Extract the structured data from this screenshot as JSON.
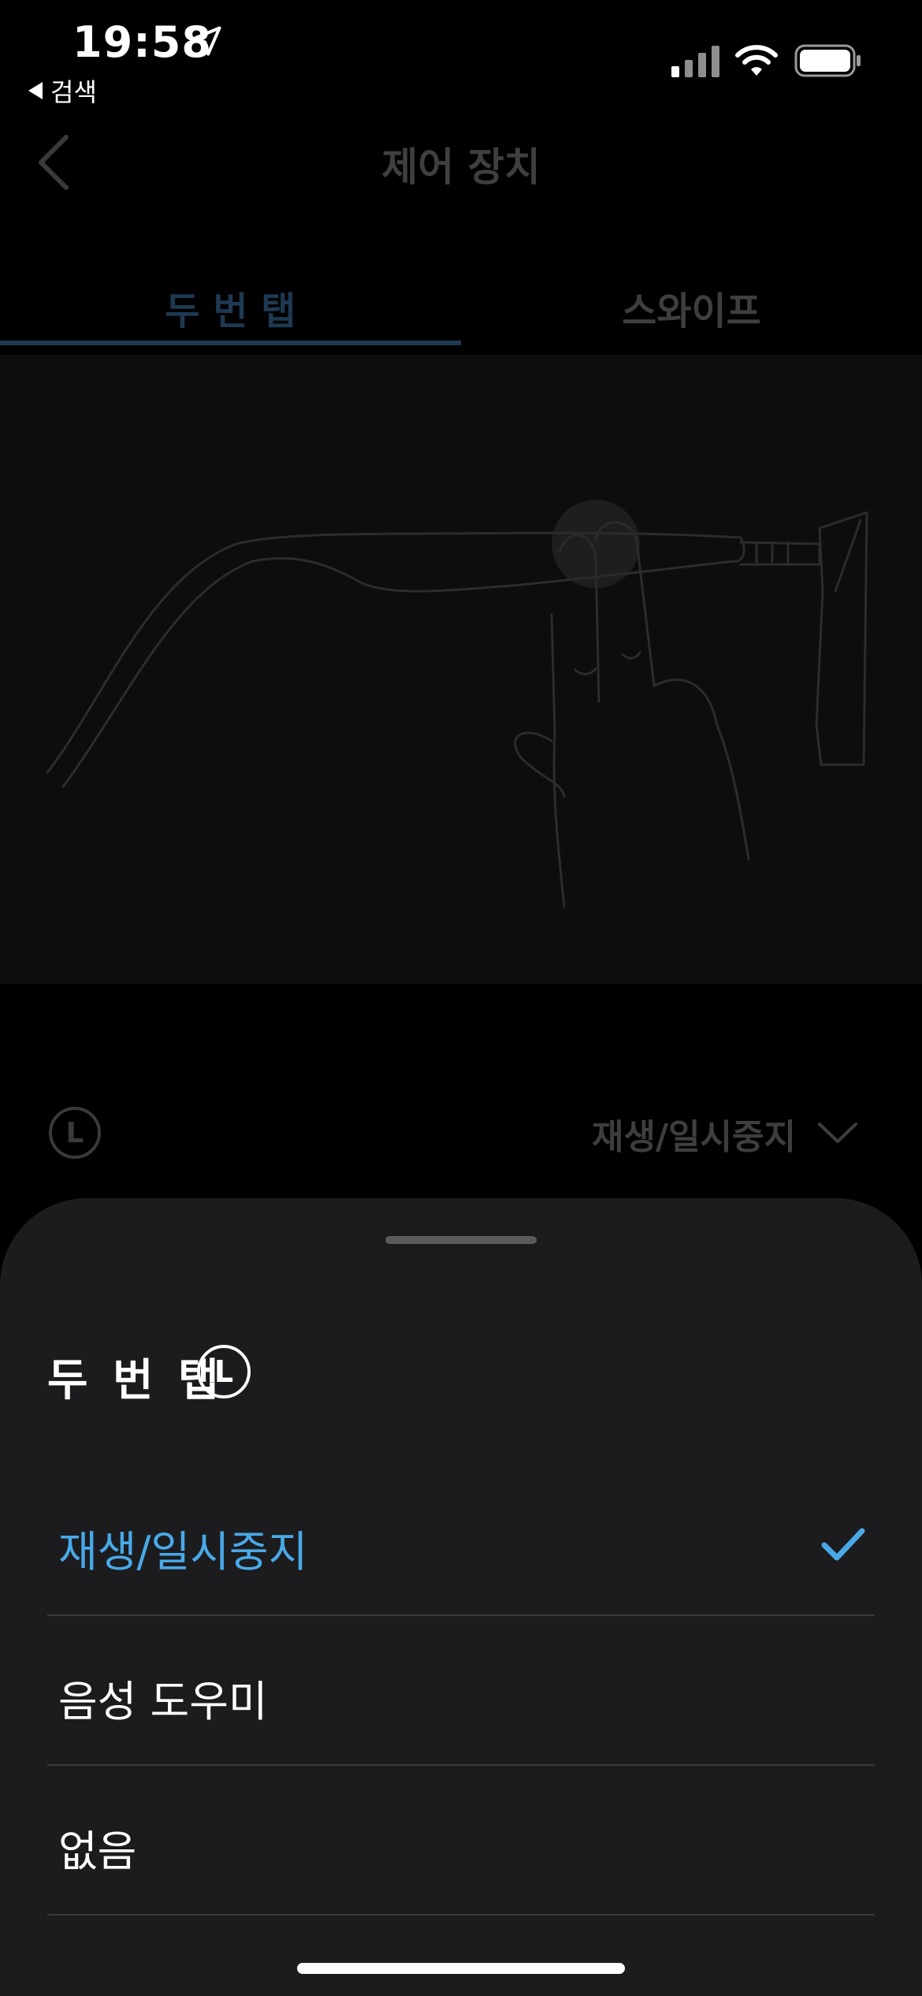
{
  "status_bar": {
    "time": "19:58",
    "back_app_label": "검색",
    "icons": [
      "location-arrow-icon",
      "cellular-signal-icon",
      "wifi-icon",
      "battery-icon"
    ]
  },
  "nav": {
    "title": "제어 장치",
    "back_icon": "chevron-left-icon"
  },
  "tabs": [
    {
      "label": "두 번 탭",
      "selected": true
    },
    {
      "label": "스와이프",
      "selected": false
    }
  ],
  "illustration": {
    "icon": "glasses-double-tap-illustration"
  },
  "background_row": {
    "side_badge": "L",
    "value": "재생/일시중지",
    "icon": "chevron-down-icon"
  },
  "sheet": {
    "title": "두 번 탭",
    "side_badge": "L",
    "options": [
      {
        "label": "재생/일시중지",
        "selected": true
      },
      {
        "label": "음성 도우미",
        "selected": false
      },
      {
        "label": "없음",
        "selected": false
      }
    ],
    "check_icon": "checkmark-icon"
  },
  "colors": {
    "background": "#000000",
    "sheet_background": "#1c1c1e",
    "accent": "#49a9e8",
    "divider": "#3a3a3c",
    "dimmed_text": "#3e3e3e"
  }
}
